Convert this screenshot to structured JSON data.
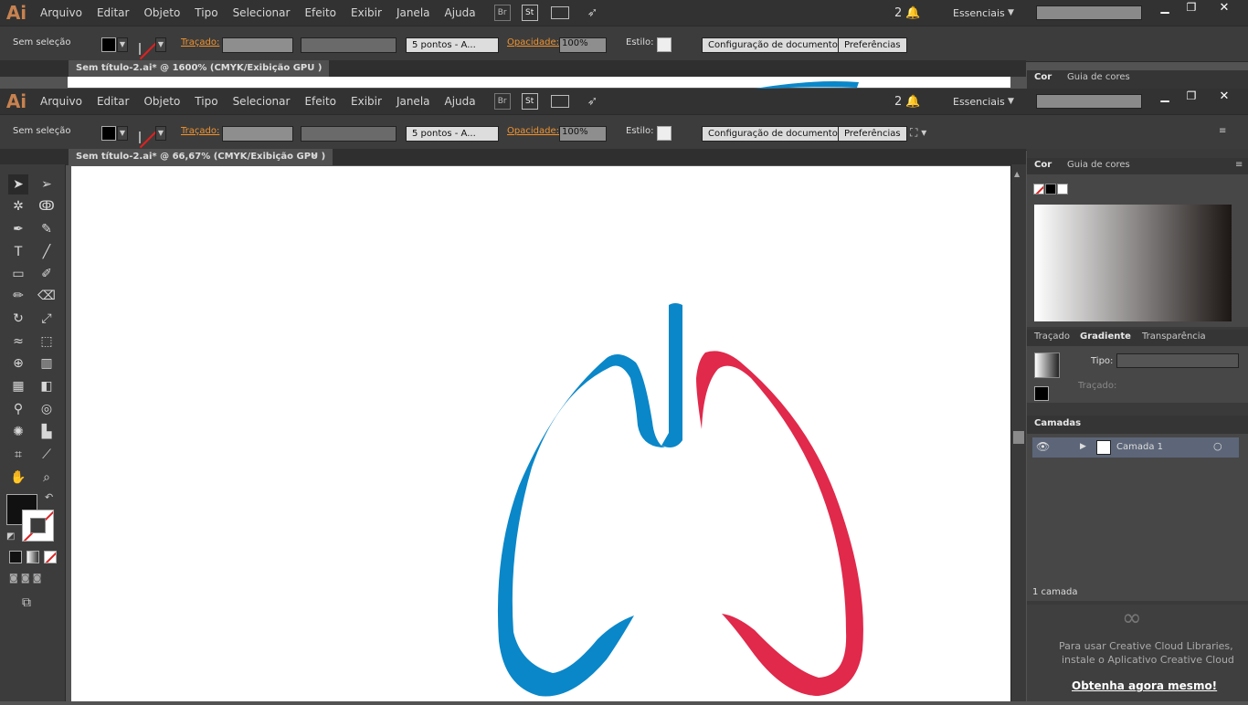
{
  "app_logo": "Ai",
  "menu": [
    "Arquivo",
    "Editar",
    "Objeto",
    "Tipo",
    "Selecionar",
    "Efeito",
    "Exibir",
    "Janela",
    "Ajuda"
  ],
  "bridge_label": "Br",
  "stock_label": "St",
  "notifications": "2",
  "workspace": "Essenciais",
  "control": {
    "selection": "Sem seleção",
    "stroke_label": "Traçado:",
    "brush": "5 pontos - A...",
    "opacity_label": "Opacidade:",
    "opacity": "100%",
    "style_label": "Estilo:",
    "doc_setup": "Configuração de documento",
    "prefs": "Preferências"
  },
  "back_doc_tab": "Sem título-2.ai* @ 1600% (CMYK/Exibição GPU )",
  "doc_tab": "Sem título-2.ai* @ 66,67% (CMYK/Exibição GPU )",
  "panels": {
    "color_tab": "Cor",
    "guide_tab": "Guia de cores",
    "stroke_tab": "Traçado",
    "gradient_tab": "Gradiente",
    "transparency_tab": "Transparência",
    "type_label": "Tipo:",
    "gradient_stroke_label": "Traçado:",
    "layers_tab": "Camadas",
    "layer_name": "Camada 1",
    "layer_count": "1 camada",
    "cc_msg1": "Para usar Creative Cloud Libraries,",
    "cc_msg2": "instale o Aplicativo Creative Cloud",
    "cc_link": "Obtenha agora mesmo!"
  },
  "colors": {
    "blue_lung": "#0a87c9",
    "red_lung": "#e0294b",
    "app_bg": "#535353"
  }
}
